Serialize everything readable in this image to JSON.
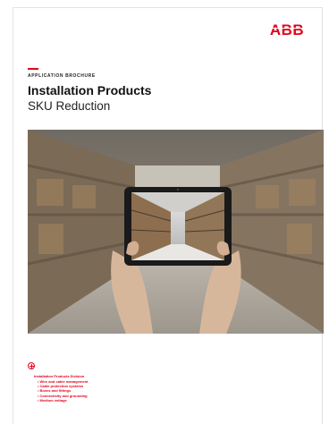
{
  "brand": {
    "logo_text": "ABB",
    "accent_color": "#e3001b"
  },
  "cover": {
    "eyebrow": "APPLICATION BROCHURE",
    "title": "Installation Products",
    "subtitle": "SKU Reduction"
  },
  "photo": {
    "icon": "warehouse-tablet-photo"
  },
  "footer": {
    "plus_icon": "plus-circle-icon",
    "division": "Installation Products Division",
    "items": [
      "Wire and cable management",
      "Cable protection systems",
      "Boxes and fittings",
      "Connectivity and grounding",
      "Medium voltage"
    ]
  }
}
